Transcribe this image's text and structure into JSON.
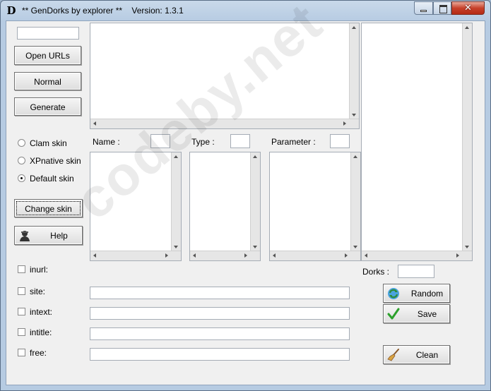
{
  "window": {
    "title": "** GenDorks by explorer **    Version: 1.3.1",
    "app_icon": "D",
    "close_glyph": "✕"
  },
  "left_panel": {
    "open_urls_label": "Open URLs",
    "normal_label": "Normal",
    "generate_label": "Generate",
    "skins": [
      {
        "label": "Clam skin",
        "checked": false
      },
      {
        "label": "XPnative skin",
        "checked": false
      },
      {
        "label": "Default skin",
        "checked": true
      }
    ],
    "change_skin_label": "Change skin",
    "help_label": "Help"
  },
  "columns": {
    "name_label": "Name :",
    "type_label": "Type :",
    "parameter_label": "Parameter :"
  },
  "operators": [
    {
      "label": "inurl:",
      "has_field": false
    },
    {
      "label": "site:",
      "has_field": true
    },
    {
      "label": "intext:",
      "has_field": true
    },
    {
      "label": "intitle:",
      "has_field": true
    },
    {
      "label": "free:",
      "has_field": true
    }
  ],
  "right_panel": {
    "dorks_label": "Dorks :",
    "random_label": "Random",
    "save_label": "Save",
    "clean_label": "Clean"
  },
  "watermark": "codeby.net",
  "icons": {
    "help": "user-silhouette-icon",
    "random": "refresh-arrows-icon",
    "save": "checkmark-icon",
    "clean": "broom-icon"
  }
}
